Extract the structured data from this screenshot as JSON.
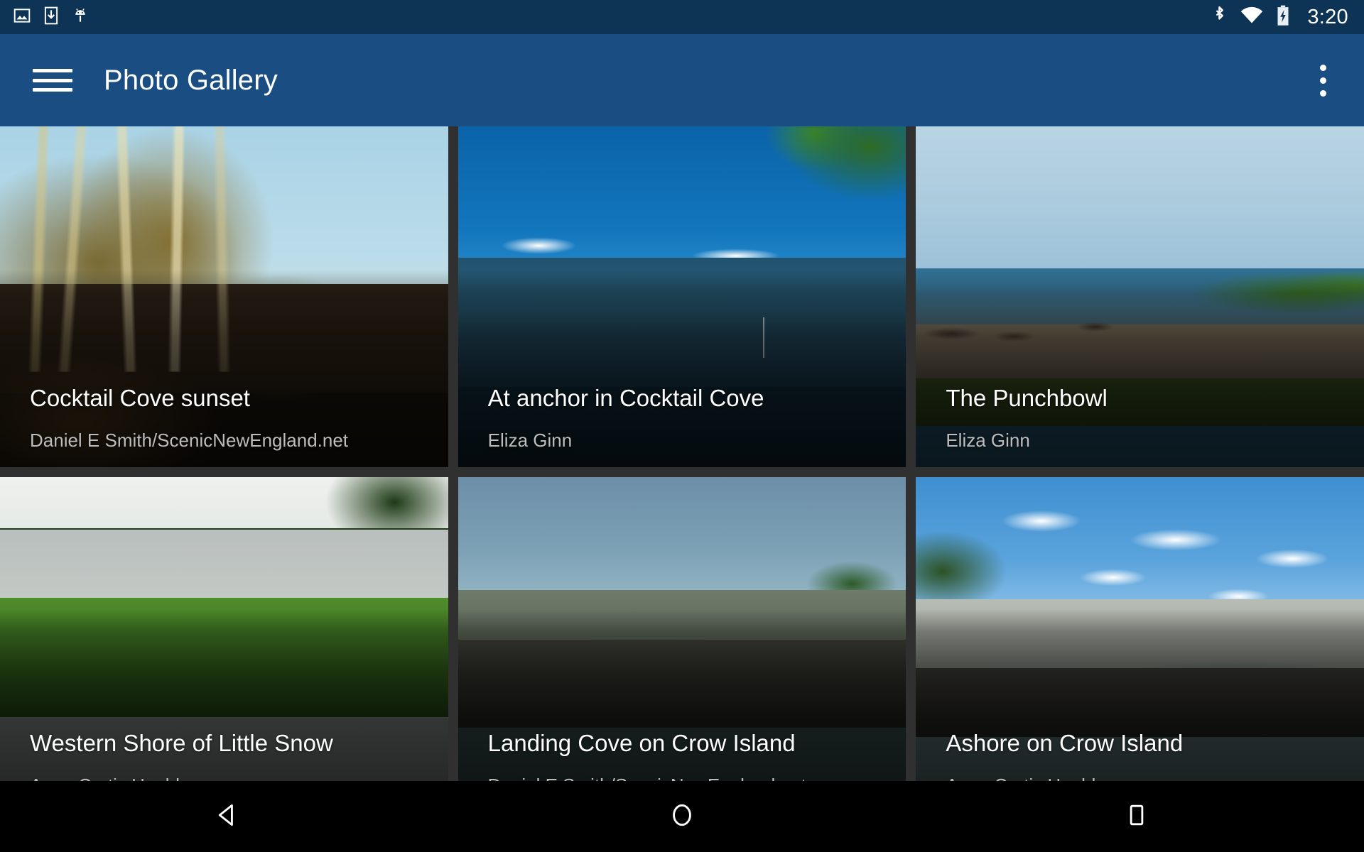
{
  "status_bar": {
    "background": "#0d3355",
    "notification_icons": [
      "image-icon",
      "download-icon",
      "android-icon"
    ],
    "system_icons": [
      "bluetooth-icon",
      "wifi-icon",
      "battery-charging-icon"
    ],
    "clock": "3:20"
  },
  "app_bar": {
    "background": "#1a4d82",
    "menu_icon": "hamburger-menu-icon",
    "title": "Photo Gallery",
    "overflow_icon": "more-vertical-icon"
  },
  "grid": {
    "background": "#303030",
    "columns": 3,
    "rows": 2,
    "photos": [
      {
        "title": "Cocktail Cove sunset",
        "author": "Daniel E Smith/ScenicNewEngland.net"
      },
      {
        "title": "At anchor in Cocktail Cove",
        "author": "Eliza Ginn"
      },
      {
        "title": "The Punchbowl",
        "author": "Eliza Ginn"
      },
      {
        "title": "Western Shore of Little Snow",
        "author": "Anne Curtis Heald"
      },
      {
        "title": "Landing Cove on Crow Island",
        "author": "Daniel E Smith/ScenicNewEngland.net"
      },
      {
        "title": "Ashore on Crow Island",
        "author": "Anne Curtis Heald"
      }
    ]
  },
  "nav_bar": {
    "background": "#000000",
    "buttons": [
      {
        "name": "back-button",
        "icon": "triangle-left-icon"
      },
      {
        "name": "home-button",
        "icon": "circle-icon"
      },
      {
        "name": "recents-button",
        "icon": "square-icon"
      }
    ]
  }
}
